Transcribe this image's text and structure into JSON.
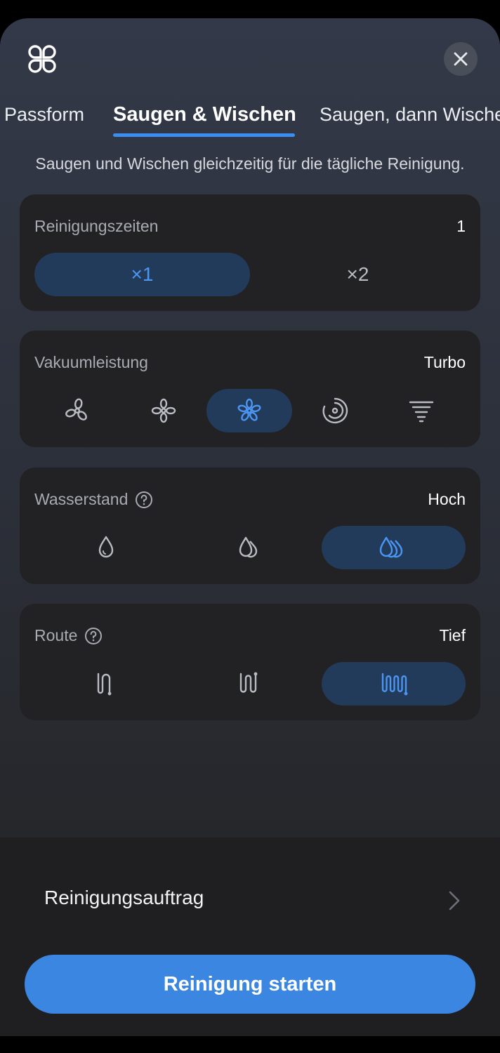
{
  "tabs": [
    {
      "label": "Passform"
    },
    {
      "label": "Saugen & Wischen"
    },
    {
      "label": "Saugen, dann Wischen"
    }
  ],
  "active_tab": "Saugen & Wischen",
  "description": "Saugen und Wischen gleichzeitig für die tägliche Reinigung.",
  "cleaning_times": {
    "title": "Reinigungszeiten",
    "value": "1",
    "options": [
      {
        "label": "×1",
        "selected": true
      },
      {
        "label": "×2",
        "selected": false
      }
    ]
  },
  "suction": {
    "title": "Vakuumleistung",
    "value": "Turbo",
    "options": [
      {
        "icon": "fan-quiet-icon",
        "selected": false
      },
      {
        "icon": "fan-standard-icon",
        "selected": false
      },
      {
        "icon": "fan-turbo-icon",
        "selected": true
      },
      {
        "icon": "fan-max-icon",
        "selected": false
      },
      {
        "icon": "tornado-icon",
        "selected": false
      }
    ]
  },
  "water": {
    "title": "Wasserstand",
    "value": "Hoch",
    "options": [
      {
        "icon": "water-low-icon",
        "selected": false
      },
      {
        "icon": "water-medium-icon",
        "selected": false
      },
      {
        "icon": "water-high-icon",
        "selected": true
      }
    ]
  },
  "route": {
    "title": "Route",
    "value": "Tief",
    "options": [
      {
        "icon": "route-fast-icon",
        "selected": false
      },
      {
        "icon": "route-standard-icon",
        "selected": false
      },
      {
        "icon": "route-deep-icon",
        "selected": true
      }
    ]
  },
  "bottom": {
    "order_label": "Reinigungsauftrag",
    "start_label": "Reinigung starten"
  },
  "colors": {
    "accent": "#3d8ef2",
    "selected_bg": "#233b5a",
    "icon_gray": "#b9bcc3",
    "card_bg": "#222225"
  }
}
